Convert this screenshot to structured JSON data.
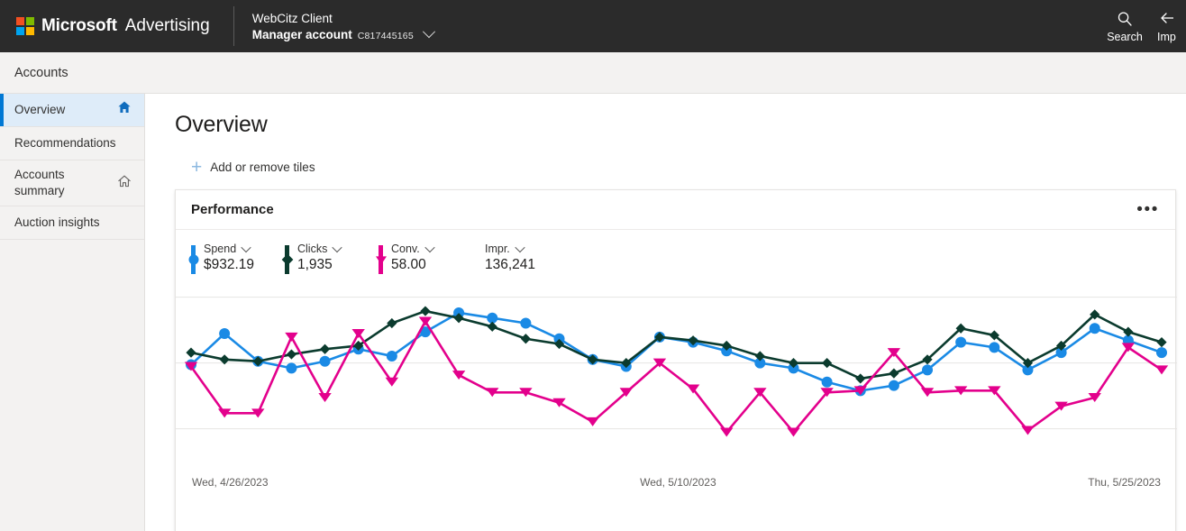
{
  "topbar": {
    "brand": "Microsoft",
    "product": "Advertising",
    "client_name": "WebCitz Client",
    "account_type": "Manager account",
    "account_id": "C817445165",
    "account_chevron_icon": "chevron-down-icon",
    "actions": [
      {
        "label": "Search",
        "icon": "search-icon"
      },
      {
        "label": "Imp",
        "icon": "arrow-left-icon"
      }
    ]
  },
  "subbar": {
    "title": "Accounts"
  },
  "sidebar": {
    "items": [
      {
        "label": "Overview",
        "icon": "home-filled-icon",
        "selected": true
      },
      {
        "label": "Recommendations",
        "icon": "",
        "selected": false
      },
      {
        "label": "Accounts summary",
        "icon": "home-outline-icon",
        "selected": false
      },
      {
        "label": "Auction insights",
        "icon": "",
        "selected": false
      }
    ]
  },
  "main": {
    "page_title": "Overview",
    "add_remove_tiles": {
      "label": "Add or remove tiles",
      "icon": "plus-icon"
    },
    "card": {
      "title": "Performance",
      "more_menu": {
        "label": "•••",
        "icon": "ellipsis-icon"
      },
      "metrics": [
        {
          "name": "Spend",
          "value": "$932.19",
          "color": "#1a8ae5",
          "marker": "circle",
          "has_indicator": true,
          "chevron_icon": "chevron-down-icon"
        },
        {
          "name": "Clicks",
          "value": "1,935",
          "color": "#0b3b2e",
          "marker": "diamond",
          "has_indicator": true,
          "chevron_icon": "chevron-down-icon"
        },
        {
          "name": "Conv.",
          "value": "58.00",
          "color": "#e3008c",
          "marker": "tri",
          "has_indicator": true,
          "chevron_icon": "chevron-down-icon"
        },
        {
          "name": "Impr.",
          "value": "136,241",
          "color": "#8a8886",
          "marker": "none",
          "has_indicator": false,
          "chevron_icon": "chevron-down-icon"
        }
      ]
    }
  },
  "chart_data": {
    "type": "line",
    "title": "Performance",
    "xlabel": "",
    "ylabel": "",
    "grid": true,
    "legend_position": "top",
    "x_tick_labels": [
      "Wed, 4/26/2023",
      "Wed, 5/10/2023",
      "Thu, 5/25/2023"
    ],
    "x": [
      "4/26/2023",
      "4/27/2023",
      "4/28/2023",
      "4/29/2023",
      "4/30/2023",
      "5/1/2023",
      "5/2/2023",
      "5/3/2023",
      "5/4/2023",
      "5/5/2023",
      "5/6/2023",
      "5/7/2023",
      "5/8/2023",
      "5/9/2023",
      "5/10/2023",
      "5/11/2023",
      "5/12/2023",
      "5/13/2023",
      "5/14/2023",
      "5/15/2023",
      "5/16/2023",
      "5/17/2023",
      "5/18/2023",
      "5/19/2023",
      "5/20/2023",
      "5/21/2023",
      "5/22/2023",
      "5/23/2023",
      "5/24/2023",
      "5/25/2023"
    ],
    "ylim": [
      0,
      100
    ],
    "gridlines": [
      20,
      58,
      96
    ],
    "series": [
      {
        "name": "Spend",
        "color": "#1a8ae5",
        "marker": "circle",
        "values": [
          57,
          75,
          59,
          55,
          59,
          66,
          62,
          76,
          87,
          84,
          81,
          72,
          60,
          56,
          73,
          70,
          65,
          58,
          55,
          47,
          42,
          45,
          54,
          70,
          67,
          54,
          64,
          78,
          71,
          64
        ]
      },
      {
        "name": "Clicks",
        "color": "#0b3b2e",
        "marker": "diamond",
        "values": [
          64,
          60,
          59,
          63,
          66,
          68,
          81,
          88,
          84,
          79,
          72,
          69,
          60,
          58,
          73,
          71,
          68,
          62,
          58,
          58,
          49,
          52,
          60,
          78,
          74,
          58,
          68,
          86,
          76,
          70
        ]
      },
      {
        "name": "Conv.",
        "color": "#e3008c",
        "marker": "triangle-down",
        "values": [
          56,
          29,
          29,
          73,
          38,
          75,
          47,
          82,
          51,
          41,
          41,
          35,
          24,
          41,
          58,
          43,
          18,
          41,
          18,
          41,
          42,
          64,
          41,
          42,
          42,
          19,
          33,
          38,
          67,
          54
        ]
      }
    ]
  }
}
